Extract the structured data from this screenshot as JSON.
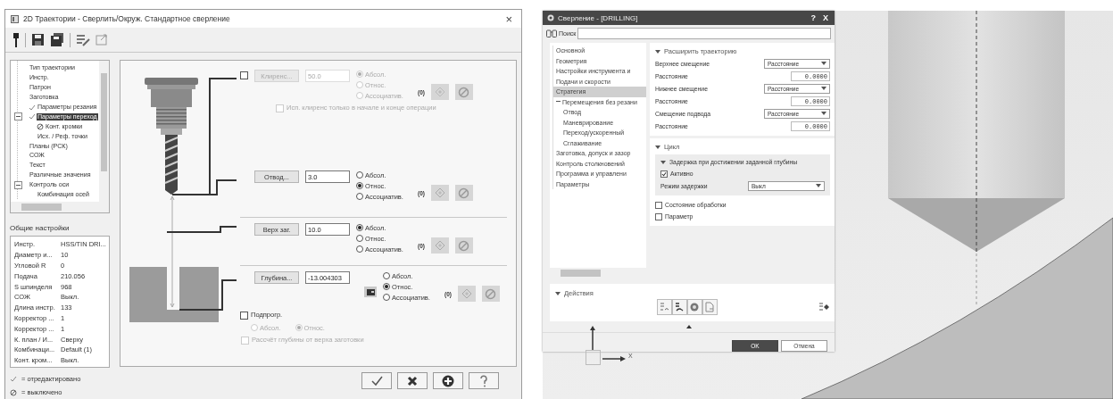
{
  "left_dialog": {
    "title": "2D Траектории - Сверлить/Окруж. Стандартное сверление",
    "close": "×",
    "tree": [
      {
        "label": "Тип траектории",
        "edited": false,
        "off": false,
        "selected": false
      },
      {
        "label": "Инстр.",
        "edited": false,
        "off": false,
        "selected": false
      },
      {
        "label": "Патрон",
        "edited": false,
        "off": false,
        "selected": false
      },
      {
        "label": "Заготовка",
        "edited": false,
        "off": false,
        "selected": false
      },
      {
        "label": "Параметры резания",
        "edited": true,
        "off": false,
        "selected": false
      },
      {
        "label": "Параметры переход",
        "edited": true,
        "off": false,
        "selected": true,
        "expanded": true,
        "children": [
          {
            "label": "Конт. кромки",
            "edited": false,
            "off": true,
            "selected": false
          },
          {
            "label": "Исх. / Реф. точки",
            "edited": false,
            "off": false,
            "selected": false
          }
        ]
      },
      {
        "label": "Планы (РСК)",
        "edited": false,
        "off": false,
        "selected": false
      },
      {
        "label": "СОЖ",
        "edited": false,
        "off": false,
        "selected": false
      },
      {
        "label": "Текст",
        "edited": false,
        "off": false,
        "selected": false
      },
      {
        "label": "Различные значения",
        "edited": false,
        "off": false,
        "selected": false
      },
      {
        "label": "Контроль оси",
        "edited": false,
        "off": false,
        "selected": false,
        "expanded": true,
        "children": [
          {
            "label": "Комбинация осей",
            "edited": false,
            "off": false,
            "selected": false
          }
        ]
      }
    ],
    "general_settings": {
      "title": "Общие настройки",
      "rows": [
        {
          "name": "Инстр.",
          "value": "HSS/TIN DRI..."
        },
        {
          "name": "Диаметр и...",
          "value": "10"
        },
        {
          "name": "Угловой R",
          "value": "0"
        },
        {
          "name": "Подача",
          "value": "210.056"
        },
        {
          "name": "S шпинделя",
          "value": "968"
        },
        {
          "name": "СОЖ",
          "value": "Выкл."
        },
        {
          "name": "Длина инстр.",
          "value": "133"
        },
        {
          "name": "Корректор ...",
          "value": "1"
        },
        {
          "name": "Корректор ...",
          "value": "1"
        },
        {
          "name": "К. план / И...",
          "value": "Сверху"
        },
        {
          "name": "Комбинаци...",
          "value": "Default (1)"
        },
        {
          "name": "Конт. кром...",
          "value": "Выкл."
        }
      ]
    },
    "legend": [
      {
        "kind": "edited",
        "text": "= отредактировано"
      },
      {
        "kind": "off",
        "text": "= выключено"
      }
    ],
    "sections": [
      {
        "checkbox": {
          "checked": false
        },
        "button": "Клиренс...",
        "value": "50.0",
        "disabled": true,
        "radios": [
          {
            "label": "Абсол.",
            "selected": true
          },
          {
            "label": "Относ.",
            "selected": false
          },
          {
            "label": "Ассоциатив.",
            "selected": false
          }
        ],
        "count": "(0)",
        "option": {
          "label": "Исп. клиренс только в начале и конце операции",
          "checked": false
        }
      },
      {
        "button": "Отвод...",
        "value": "3.0",
        "disabled": false,
        "radios": [
          {
            "label": "Абсол.",
            "selected": false
          },
          {
            "label": "Относ.",
            "selected": true
          },
          {
            "label": "Ассоциатив.",
            "selected": false
          }
        ],
        "count": "(0)"
      },
      {
        "button": "Верх заг.",
        "value": "10.0",
        "disabled": false,
        "radios": [
          {
            "label": "Абсол.",
            "selected": true
          },
          {
            "label": "Относ.",
            "selected": false
          },
          {
            "label": "Ассоциатив.",
            "selected": false
          }
        ],
        "count": "(0)"
      },
      {
        "button": "Глубина...",
        "value": "-13.004303",
        "disabled": false,
        "radios": [
          {
            "label": "Абсол.",
            "selected": false
          },
          {
            "label": "Относ.",
            "selected": true
          },
          {
            "label": "Ассоциатив.",
            "selected": false
          }
        ],
        "count": "(0)",
        "subprogram": {
          "label": "Подпрогр.",
          "checked": false,
          "radios": [
            {
              "label": "Абсол.",
              "selected": false
            },
            {
              "label": "Относ.",
              "selected": true
            }
          ]
        },
        "option": {
          "label": "Рассчёт глубины от верха заготовки",
          "checked": false
        }
      }
    ]
  },
  "right_dialog": {
    "title": "Сверление - [DRILLING]",
    "help": "?",
    "close": "X",
    "search_label": "Поиск",
    "tree": [
      {
        "label": "Основной",
        "selected": false
      },
      {
        "label": "Геометрия",
        "selected": false
      },
      {
        "label": "Настройки инструмента и",
        "selected": false
      },
      {
        "label": "Подачи и скорости",
        "selected": false
      },
      {
        "label": "Стратегия",
        "selected": true
      },
      {
        "label": "Перемещения без резани",
        "selected": false,
        "expanded": true,
        "children": [
          {
            "label": "Отвод",
            "selected": false
          },
          {
            "label": "Маневрирование",
            "selected": false
          },
          {
            "label": "Переход/ускоренный",
            "selected": false
          },
          {
            "label": "Сглаживание",
            "selected": false
          }
        ]
      },
      {
        "label": "Заготовка, допуск и зазор",
        "selected": false
      },
      {
        "label": "Контроль столкновений",
        "selected": false
      },
      {
        "label": "Программа и управлени",
        "selected": false
      },
      {
        "label": "Параметры",
        "selected": false
      }
    ],
    "extend_path": {
      "title": "Расширить траекторию",
      "expanded": true,
      "rows": [
        {
          "kind": "select",
          "label": "Верхнее смещение",
          "value": "Расстояние"
        },
        {
          "kind": "number",
          "label": "Расстояние",
          "value": "0.0000"
        },
        {
          "kind": "select",
          "label": "Нижнее смещение",
          "value": "Расстояние"
        },
        {
          "kind": "number",
          "label": "Расстояние",
          "value": "0.0000"
        },
        {
          "kind": "select",
          "label": "Смещение подвода",
          "value": "Расстояние"
        },
        {
          "kind": "number",
          "label": "Расстояние",
          "value": "0.0000"
        }
      ]
    },
    "cycle": {
      "title": "Цикл",
      "expanded": true,
      "dwell": {
        "title": "Задержка при достижении заданной глубины",
        "expanded": true,
        "active": {
          "label": "Активно",
          "checked": true
        },
        "mode": {
          "label": "Режим задержки",
          "value": "Выкл"
        }
      },
      "options": [
        {
          "label": "Состояние обработки",
          "checked": false
        },
        {
          "label": "Параметр",
          "checked": false
        }
      ]
    },
    "actions": {
      "title": "Действия",
      "expanded": true
    },
    "buttons": [
      {
        "label": "OK",
        "kind": "primary"
      },
      {
        "label": "Отмена",
        "kind": "secondary"
      }
    ]
  },
  "viewport": {
    "axis_label": "X"
  }
}
